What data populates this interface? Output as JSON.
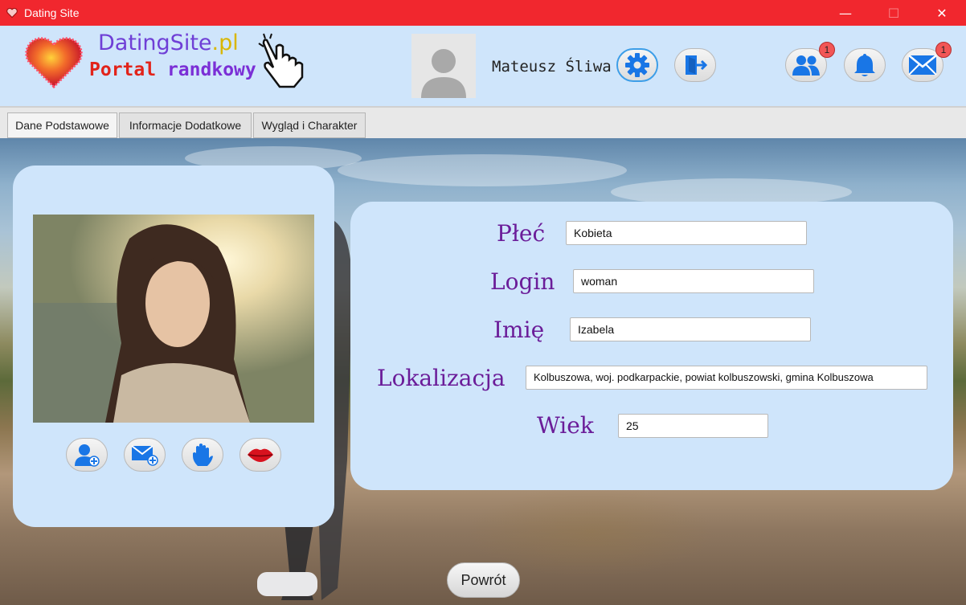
{
  "window": {
    "title": "Dating Site",
    "minimize": "—",
    "maximize": "☐",
    "close": "✕"
  },
  "header": {
    "logo": {
      "site": "DatingSite",
      "tld": ".pl",
      "portal": "Portal",
      "randkowy": "randkowy"
    },
    "user_name": "Mateusz Śliwa",
    "friends_badge": "1",
    "messages_badge": "1"
  },
  "tabs": [
    {
      "label": "Dane Podstawowe"
    },
    {
      "label": "Informacje Dodatkowe"
    },
    {
      "label": "Wygląd i Charakter"
    }
  ],
  "profile": {
    "fields": [
      {
        "label": "Płeć",
        "value": "Kobieta"
      },
      {
        "label": "Login",
        "value": "woman"
      },
      {
        "label": "Imię",
        "value": "Izabela"
      },
      {
        "label": "Lokalizacja",
        "value": "Kolbuszowa, woj. podkarpackie, powiat kolbuszowski, gmina Kolbuszowa"
      },
      {
        "label": "Wiek",
        "value": "25"
      }
    ]
  },
  "back_button": "Powrót",
  "colors": {
    "titlebar": "#f1272e",
    "panel": "#cfe5fb",
    "label": "#6b1d99",
    "icon": "#1976e6",
    "badge": "#f25656"
  }
}
